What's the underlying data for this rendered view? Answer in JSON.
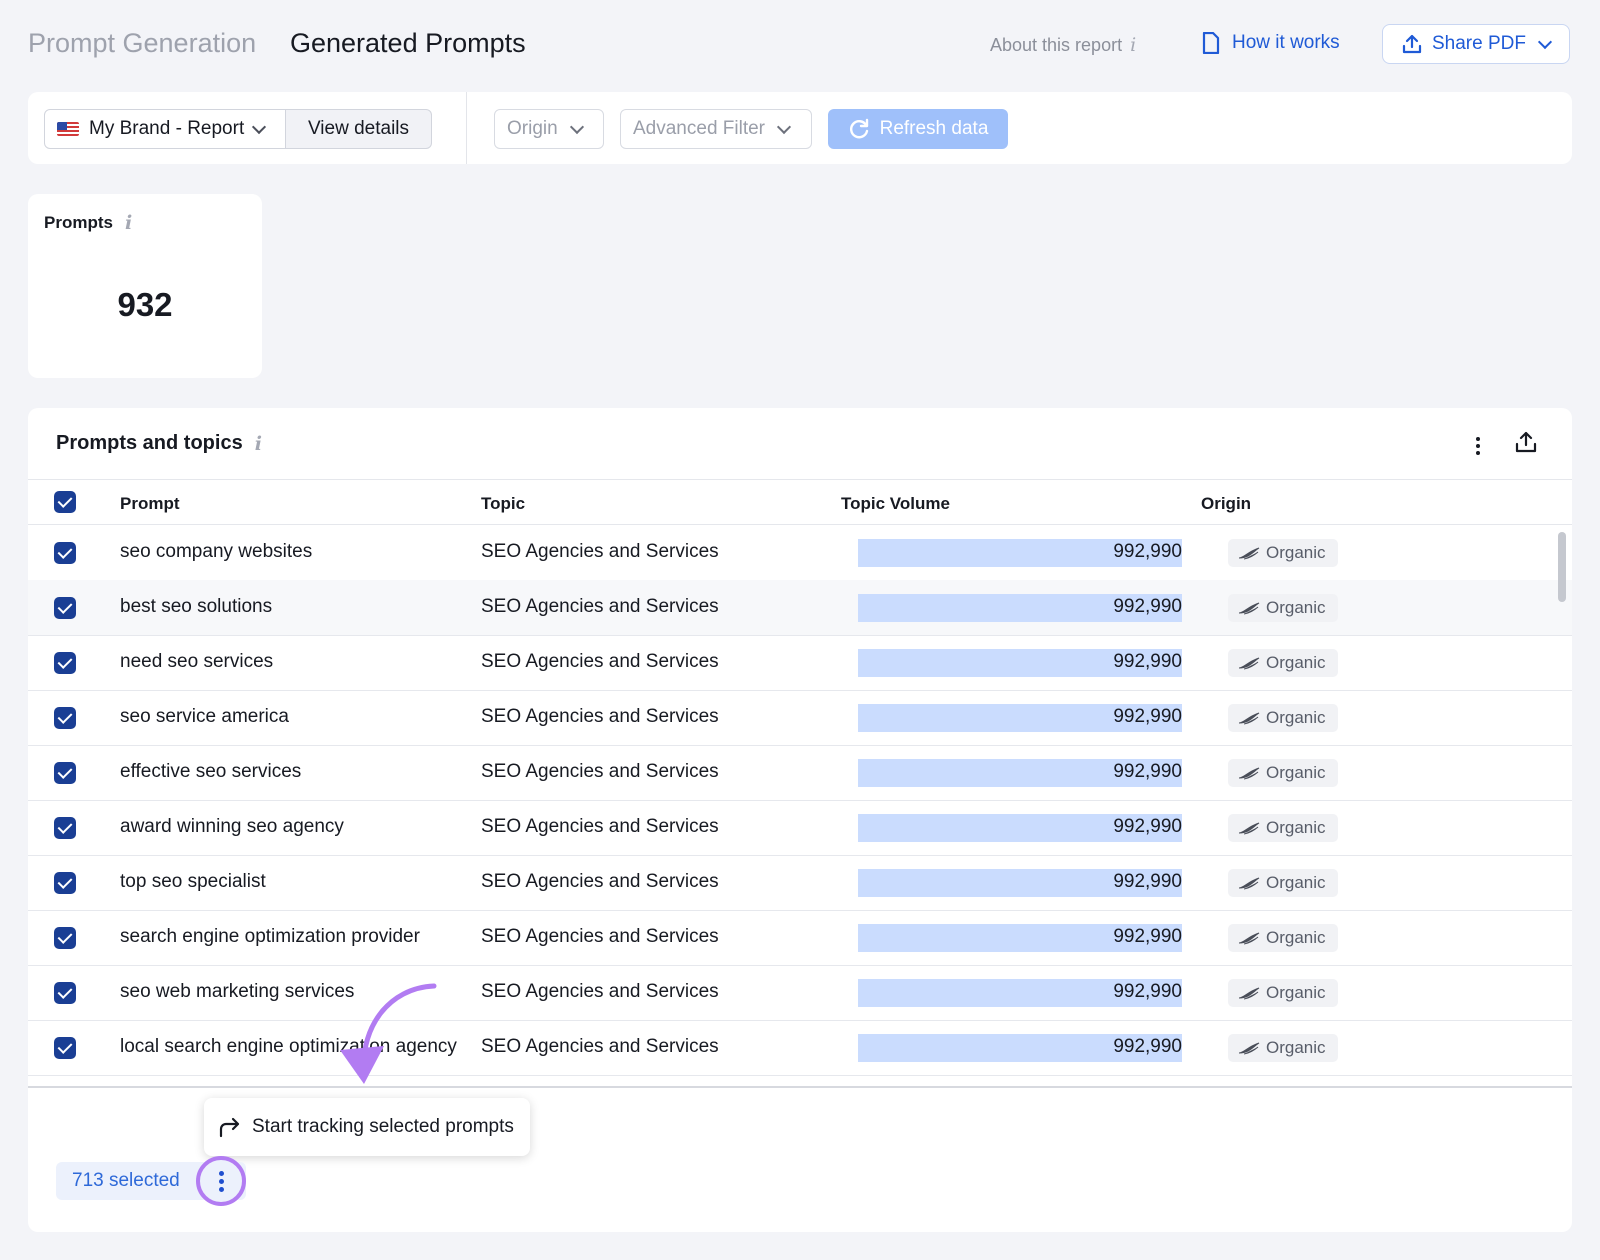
{
  "header": {
    "breadcrumb": "Prompt Generation",
    "title": "Generated Prompts",
    "about_label": "About this report",
    "how_label": "How it works",
    "share_label": "Share PDF"
  },
  "filters": {
    "brand": "My Brand - Report",
    "view_details": "View details",
    "origin": "Origin",
    "advanced": "Advanced Filter",
    "refresh": "Refresh data"
  },
  "summary": {
    "label": "Prompts",
    "value": "932"
  },
  "table": {
    "title": "Prompts and topics",
    "columns": [
      "Prompt",
      "Topic",
      "Topic Volume",
      "Origin"
    ],
    "rows": [
      {
        "prompt": "seo company websites",
        "topic": "SEO Agencies and Services",
        "volume": "992,990",
        "origin": "Organic"
      },
      {
        "prompt": "best seo solutions",
        "topic": "SEO Agencies and Services",
        "volume": "992,990",
        "origin": "Organic"
      },
      {
        "prompt": "need seo services",
        "topic": "SEO Agencies and Services",
        "volume": "992,990",
        "origin": "Organic"
      },
      {
        "prompt": "seo service america",
        "topic": "SEO Agencies and Services",
        "volume": "992,990",
        "origin": "Organic"
      },
      {
        "prompt": "effective seo services",
        "topic": "SEO Agencies and Services",
        "volume": "992,990",
        "origin": "Organic"
      },
      {
        "prompt": "award winning seo agency",
        "topic": "SEO Agencies and Services",
        "volume": "992,990",
        "origin": "Organic"
      },
      {
        "prompt": "top seo specialist",
        "topic": "SEO Agencies and Services",
        "volume": "992,990",
        "origin": "Organic"
      },
      {
        "prompt": "search engine optimization provider",
        "topic": "SEO Agencies and Services",
        "volume": "992,990",
        "origin": "Organic"
      },
      {
        "prompt": "seo web marketing services",
        "topic": "SEO Agencies and Services",
        "volume": "992,990",
        "origin": "Organic"
      },
      {
        "prompt": "local search engine optimization agency",
        "topic": "SEO Agencies and Services",
        "volume": "992,990",
        "origin": "Organic"
      }
    ]
  },
  "footer": {
    "tooltip": "Start tracking selected prompts",
    "selected": "713 selected"
  },
  "colors": {
    "accent": "#1f5ad6",
    "checkbox": "#1a3e94",
    "volume_bar": "#cadcfe",
    "annotation": "#b27cf2"
  }
}
